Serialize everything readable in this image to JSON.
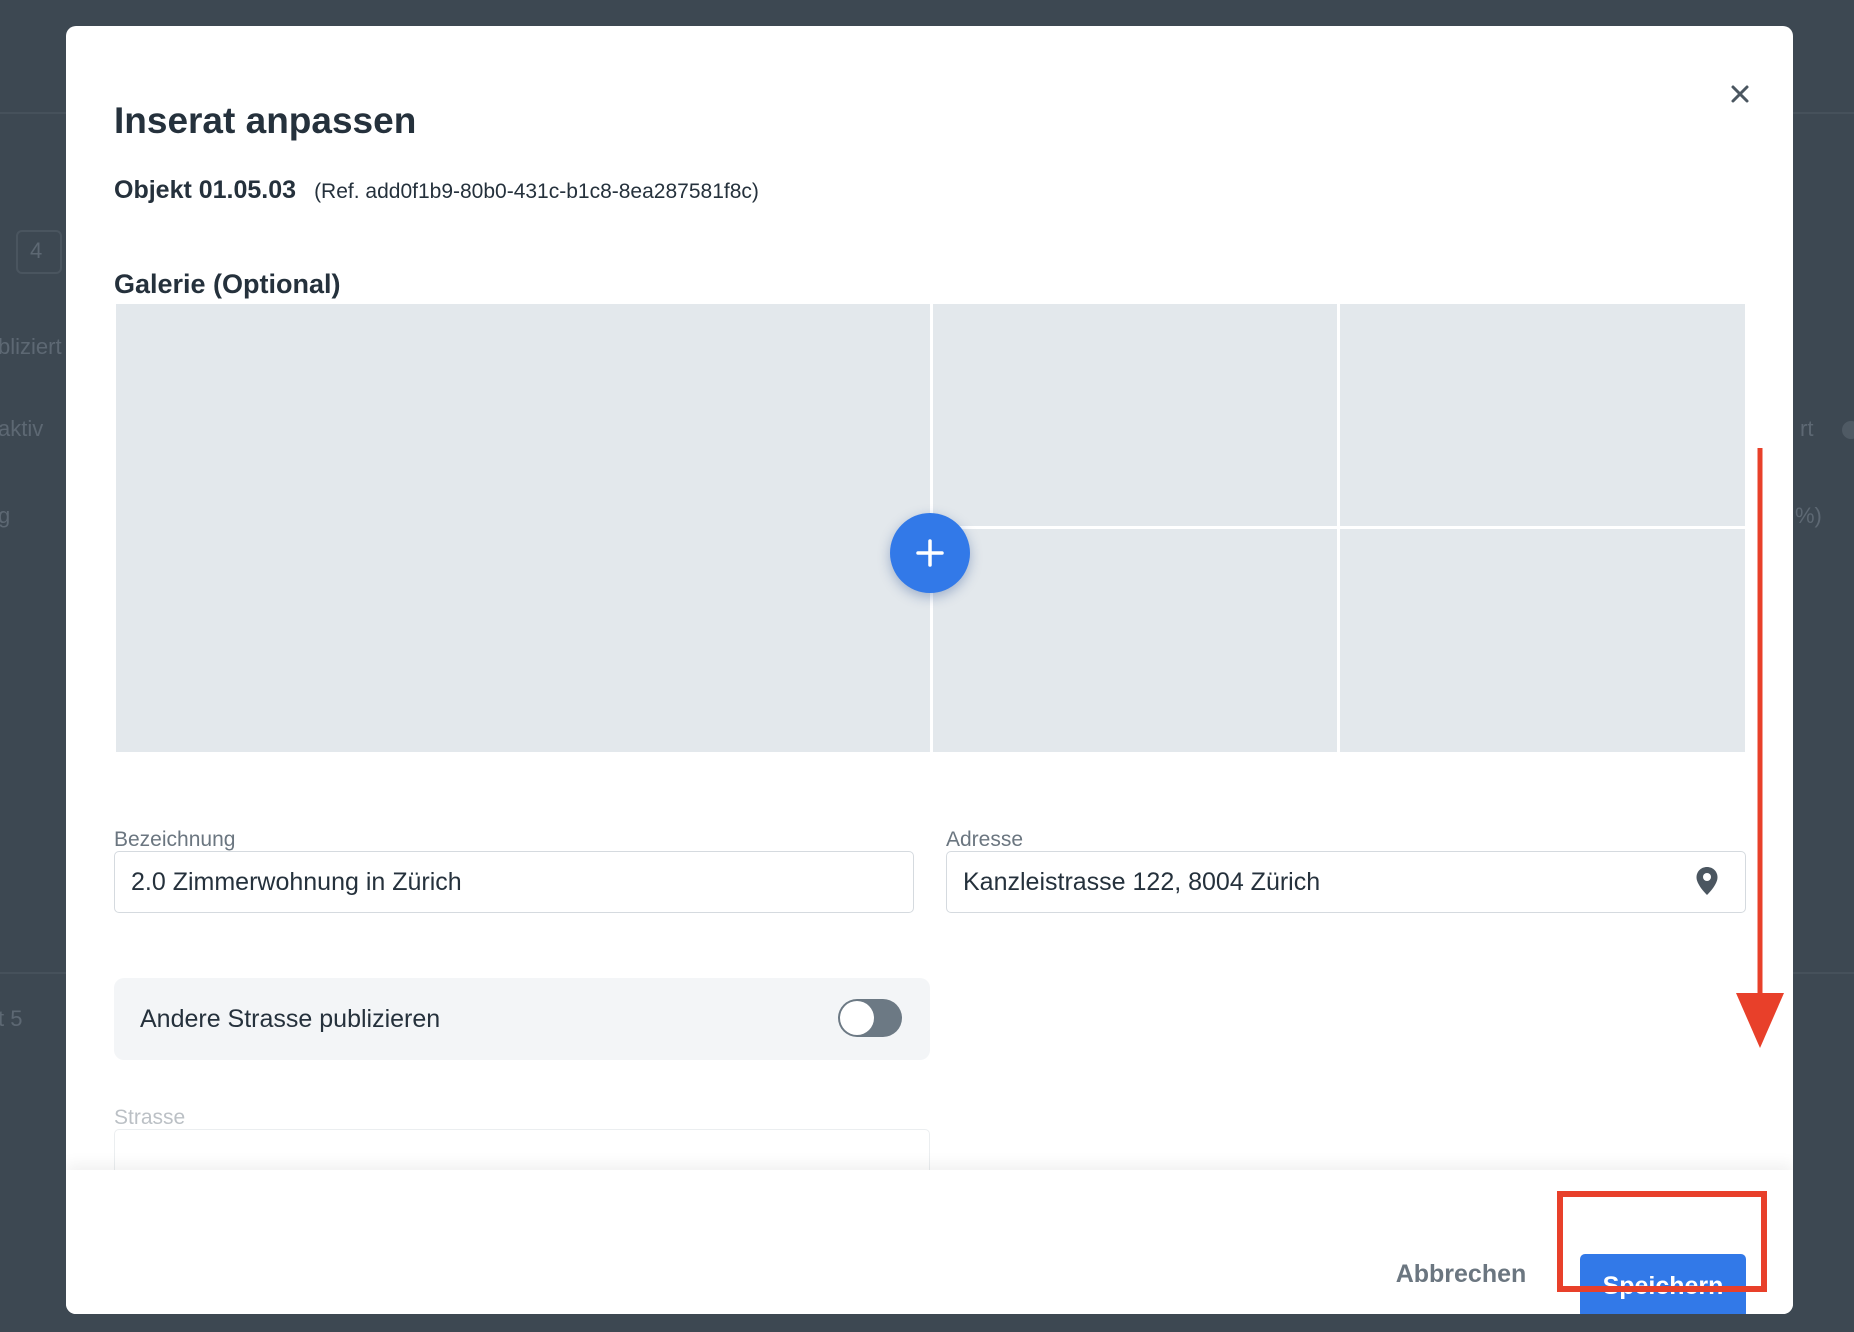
{
  "modal": {
    "title": "Inserat anpassen",
    "object_name": "Objekt 01.05.03",
    "object_ref": "(Ref. add0f1b9-80b0-431c-b1c8-8ea287581f8c)"
  },
  "gallery": {
    "title": "Galerie (Optional)",
    "add_icon": "plus-icon"
  },
  "form": {
    "designation": {
      "label": "Bezeichnung",
      "value": "2.0 Zimmerwohnung in Zürich"
    },
    "address": {
      "label": "Adresse",
      "value": "Kanzleistrasse 122, 8004 Zürich",
      "icon": "location-pin-icon"
    },
    "publish_other_street": {
      "label": "Andere Strasse publizieren",
      "enabled": false
    },
    "street": {
      "label": "Strasse",
      "value": ""
    }
  },
  "footer": {
    "cancel_label": "Abbrechen",
    "save_label": "Speichern"
  },
  "background": {
    "fragments": [
      "4",
      "bliziert",
      "aktiv",
      "g",
      "rt",
      "%)",
      "t 5"
    ]
  },
  "colors": {
    "primary": "#3279e8",
    "annotation": "#e8402a",
    "backdrop": "#3d4852",
    "text": "#25313c",
    "muted": "#6b7680",
    "gallery_tile": "#e3e8ec",
    "toggle_off": "#6c7984"
  }
}
